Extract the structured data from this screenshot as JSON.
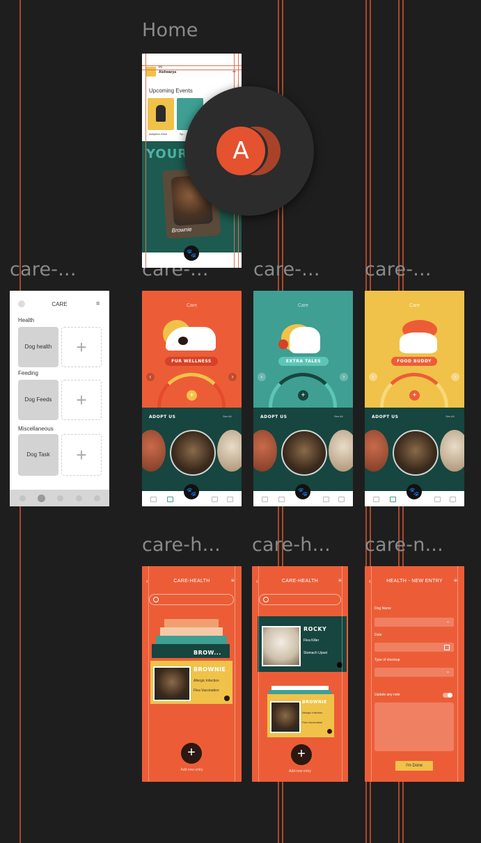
{
  "canvas": {
    "background": "#1e1e1e",
    "guide_color": "#c4502f",
    "frame_labels": {
      "home": "Home",
      "care_list": "care-...",
      "care_a": "care-...",
      "care_b": "care-...",
      "care_c": "care-...",
      "care_h1": "care-h...",
      "care_h2": "care-h...",
      "care_n": "care-n..."
    }
  },
  "avatar": {
    "initial": "A",
    "color": "#e4522f"
  },
  "home": {
    "greeting": "Hi",
    "user": "Aishwarya",
    "upcoming": "Upcoming Events",
    "event_1": "Adoption Drive",
    "event_2": "Sp...",
    "banner_word": "YOUR",
    "dog_name": "Brownie"
  },
  "care_list": {
    "title": "CARE",
    "sections": [
      {
        "heading": "Health",
        "box": "Dog health"
      },
      {
        "heading": "Feeding",
        "box": "Dog Feeds"
      },
      {
        "heading": "Miscellaneous",
        "box": "Dog Task"
      }
    ],
    "plus": "+"
  },
  "care_screens": [
    {
      "title": "Care",
      "pill": "FUR WELLNESS",
      "color": "#ec5d37",
      "adopt": "ADOPT US",
      "see": "See All"
    },
    {
      "title": "Care",
      "pill": "EXTRA TALES",
      "color": "#3f9f93",
      "adopt": "ADOPT US",
      "see": "See All"
    },
    {
      "title": "Care",
      "pill": "FOOD BUDDY",
      "color": "#f0c249",
      "adopt": "ADOPT US",
      "see": "See All"
    }
  ],
  "care_health_1": {
    "title": "CARE-HEALTH",
    "partial": "BROW...",
    "card_name": "BROWNIE",
    "item_1": "Allergic Infection",
    "item_2": "Flea Vaccination",
    "add_label": "Add new entry"
  },
  "care_health_2": {
    "title": "CARE-HEALTH",
    "card_1_name": "ROCKY",
    "card_1_item_1": "Flea Killer",
    "card_1_item_2": "Stomach Upset",
    "card_2_name": "BROWNIE",
    "card_2_item_1": "Allergic Infection",
    "card_2_item_2": "Flea Vaccination",
    "add_label": "Add new entry"
  },
  "care_new": {
    "title": "HEALTH - NEW ENTRY",
    "field_1": "Dog Name",
    "field_2": "Date",
    "field_3": "Type of checkup",
    "toggle": "Update any note",
    "done": "I'm Done"
  },
  "icons": {
    "paw": "paw-icon",
    "menu": "hamburger-icon",
    "back": "back-arrow-icon",
    "search": "search-icon"
  }
}
